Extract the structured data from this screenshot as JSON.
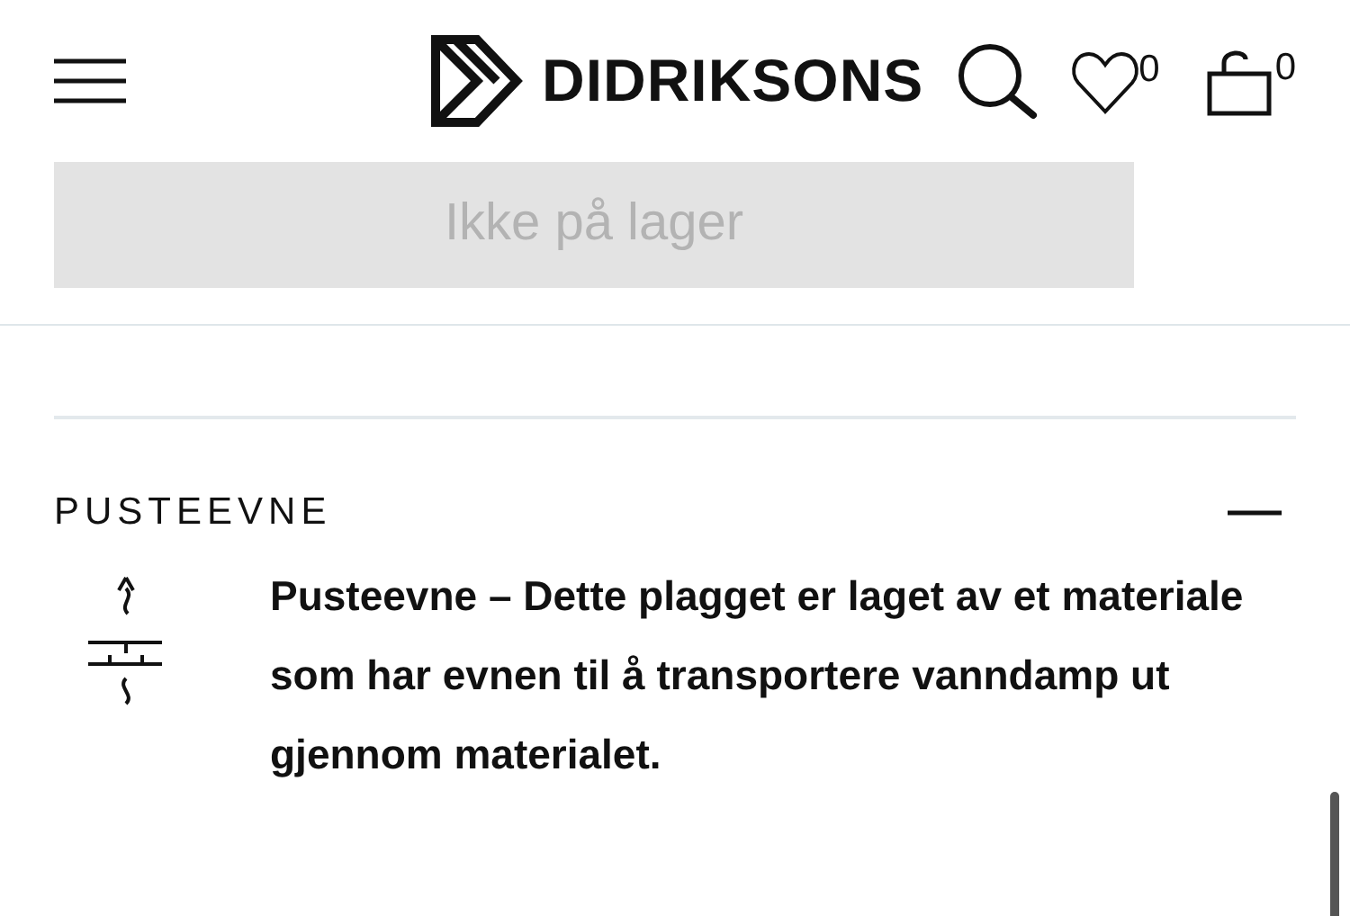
{
  "header": {
    "logo_text": "DIDRIKSONS",
    "wishlist_count": "0",
    "cart_count": "0"
  },
  "stock_button": {
    "label": "Ikke på lager",
    "disabled": true
  },
  "accordion": [
    {
      "title": "PUSTEEVNE",
      "expanded": true,
      "description": "Pusteevne – Dette plagget er laget av et materiale som har evnen til å transportere vanndamp ut gjennom materialet."
    }
  ]
}
